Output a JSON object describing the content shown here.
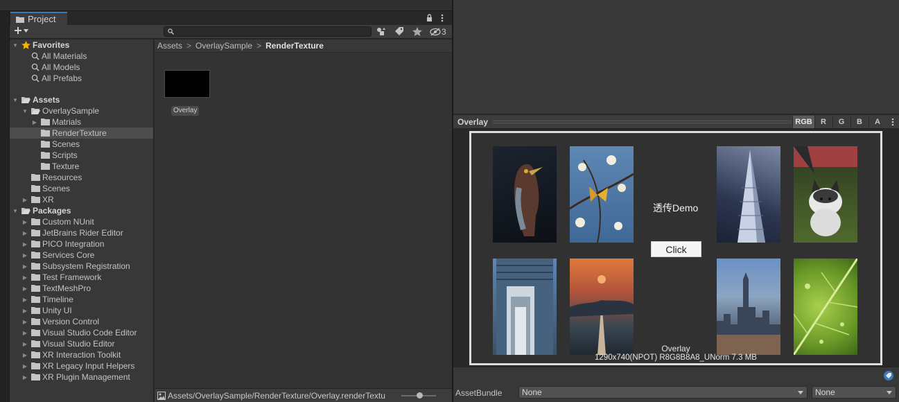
{
  "project": {
    "tab_label": "Project",
    "search_placeholder": "",
    "hidden_count": "3"
  },
  "tree": {
    "favorites": {
      "label": "Favorites",
      "items": [
        "All Materials",
        "All Models",
        "All Prefabs"
      ]
    },
    "assets": {
      "label": "Assets",
      "overlay_sample": "OverlaySample",
      "overlay_children": [
        "Matrials",
        "RenderTexture",
        "Scenes",
        "Scripts",
        "Texture"
      ],
      "others": [
        "Resources",
        "Scenes",
        "XR"
      ]
    },
    "packages": {
      "label": "Packages",
      "items": [
        "Custom NUnit",
        "JetBrains Rider Editor",
        "PICO Integration",
        "Services Core",
        "Subsystem Registration",
        "Test Framework",
        "TextMeshPro",
        "Timeline",
        "Unity UI",
        "Version Control",
        "Visual Studio Code Editor",
        "Visual Studio Editor",
        "XR Interaction Toolkit",
        "XR Legacy Input Helpers",
        "XR Plugin Management"
      ]
    }
  },
  "breadcrumb": {
    "items": [
      "Assets",
      "OverlaySample",
      "RenderTexture"
    ]
  },
  "asset": {
    "label": "Overlay"
  },
  "path_bar": {
    "path": "Assets/OverlaySample/RenderTexture/Overlay.renderTextu"
  },
  "preview": {
    "title": "Overlay",
    "channels": [
      "RGB",
      "R",
      "G",
      "B",
      "A"
    ],
    "active_channel": "RGB",
    "demo_text": "透传Demo",
    "click_label": "Click",
    "texture_name": "Overlay",
    "texture_info": "1290x740(NPOT)  R8G8B8A8_UNorm  7.3 MB"
  },
  "asset_bundle": {
    "label": "AssetBundle",
    "name_value": "None",
    "variant_value": "None"
  },
  "colors": {
    "accent": "#3a79bb",
    "selected_row": "#4d4d4d",
    "favorite_star": "#f0b400"
  },
  "icons": [
    "lock-icon",
    "kebab-menu-icon",
    "plus-icon",
    "search-icon",
    "filter-by-type-icon",
    "filter-by-label-icon",
    "favorite-star-icon",
    "hidden-packages-icon",
    "folder-icon",
    "render-texture-icon",
    "asset-label-tag-icon"
  ]
}
